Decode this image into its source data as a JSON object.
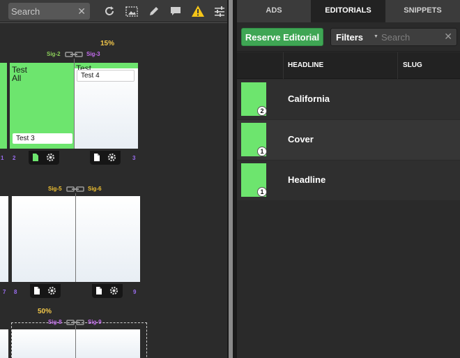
{
  "toolbar": {
    "search_placeholder": "Search",
    "clear_glyph": "✕",
    "icons": [
      "refresh-icon",
      "image-select-icon",
      "pencil-icon",
      "comment-icon",
      "warning-icon",
      "sliders-icon"
    ],
    "warning_color": "#f5c518"
  },
  "flatplan": {
    "spread1": {
      "percent": "15%",
      "sig_left": "Sig-2",
      "sig_right": "Sig-3",
      "page_left_title": "Test\nAll",
      "page_left_label": "Test 3",
      "page_right_title": "Test",
      "page_right_label": "Test 4",
      "page_num_far_left": "1",
      "page_num_left": "2",
      "page_num_right": "3"
    },
    "spread2": {
      "sig_left": "Sig-5",
      "sig_right": "Sig-6",
      "page_num_far_left": "7",
      "page_num_left": "8",
      "page_num_right": "9"
    },
    "spread3": {
      "percent": "50%",
      "sig_left": "Sig-8",
      "sig_right": "Sig-9"
    },
    "colors": {
      "assigned": "#6de56e",
      "percent": "#f3c84a",
      "page_number": "#9b6df0"
    }
  },
  "panel": {
    "tabs": [
      {
        "label": "ADS",
        "active": false
      },
      {
        "label": "EDITORIALS",
        "active": true
      },
      {
        "label": "SNIPPETS",
        "active": false
      }
    ],
    "reserve_button": "Reserve Editorial",
    "filters_label": "Filters",
    "filter_search_placeholder": "Search",
    "clear_glyph": "✕",
    "columns": [
      "HEADLINE",
      "SLUG"
    ],
    "rows": [
      {
        "headline": "California",
        "count": "2"
      },
      {
        "headline": "Cover",
        "count": "1"
      },
      {
        "headline": "Headline",
        "count": "1"
      }
    ],
    "accent": "#3fa654"
  }
}
